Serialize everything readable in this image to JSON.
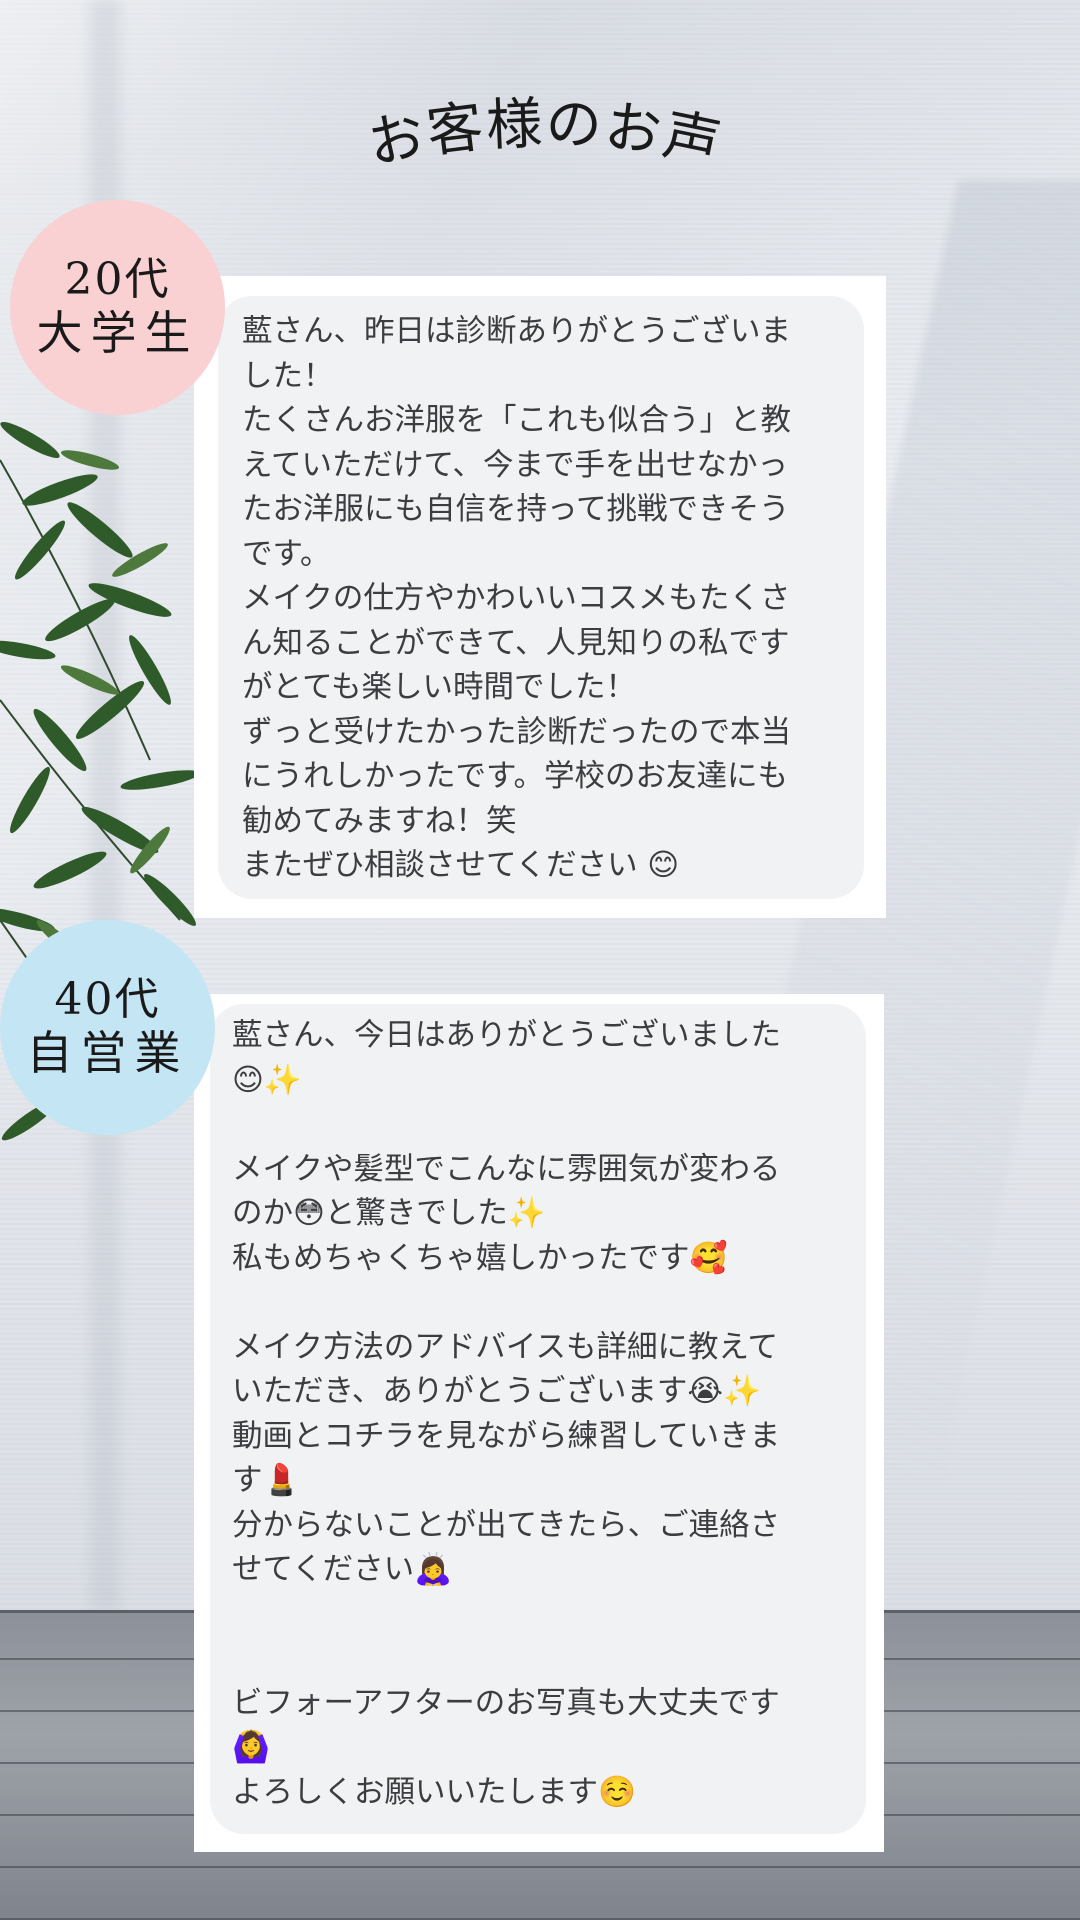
{
  "page": {
    "title": "お客様のお声"
  },
  "testimonials": [
    {
      "badge": {
        "age": "20代",
        "occupation": "大学生",
        "color": "#f9d1d3"
      },
      "lines": [
        "藍さん、昨日は診断ありがとうございま",
        "した！",
        "たくさんお洋服を「これも似合う」と教",
        "えていただけて、今まで手を出せなかっ",
        "たお洋服にも自信を持って挑戦できそう",
        "です。",
        "メイクの仕方やかわいいコスメもたくさ",
        "ん知ることができて、人見知りの私です",
        "がとても楽しい時間でした！",
        "ずっと受けたかった診断だったので本当",
        "にうれしかったです。学校のお友達にも",
        "勧めてみますね！笑",
        "またぜひ相談させてください 😊"
      ]
    },
    {
      "badge": {
        "age": "40代",
        "occupation": "自営業",
        "color": "#c4e6f4"
      },
      "lines": [
        "藍さん、今日はありがとうございました",
        "😊✨",
        "",
        "メイクや髪型でこんなに雰囲気が変わる",
        "のか😳と驚きでした✨",
        "私もめちゃくちゃ嬉しかったです🥰",
        "",
        "メイク方法のアドバイスも詳細に教えて",
        "いただき、ありがとうございます😭✨",
        "動画とコチラを見ながら練習していきま",
        "す💄",
        "分からないことが出てきたら、ご連絡さ",
        "せてください🙇‍♀️",
        "",
        "",
        "ビフォーアフターのお写真も大丈夫です",
        "🙆‍♀️",
        "よろしくお願いいたします☺️"
      ]
    }
  ],
  "colors": {
    "bubble_background": "#f1f2f4",
    "card_background": "#ffffff",
    "text": "#3c3d41"
  }
}
